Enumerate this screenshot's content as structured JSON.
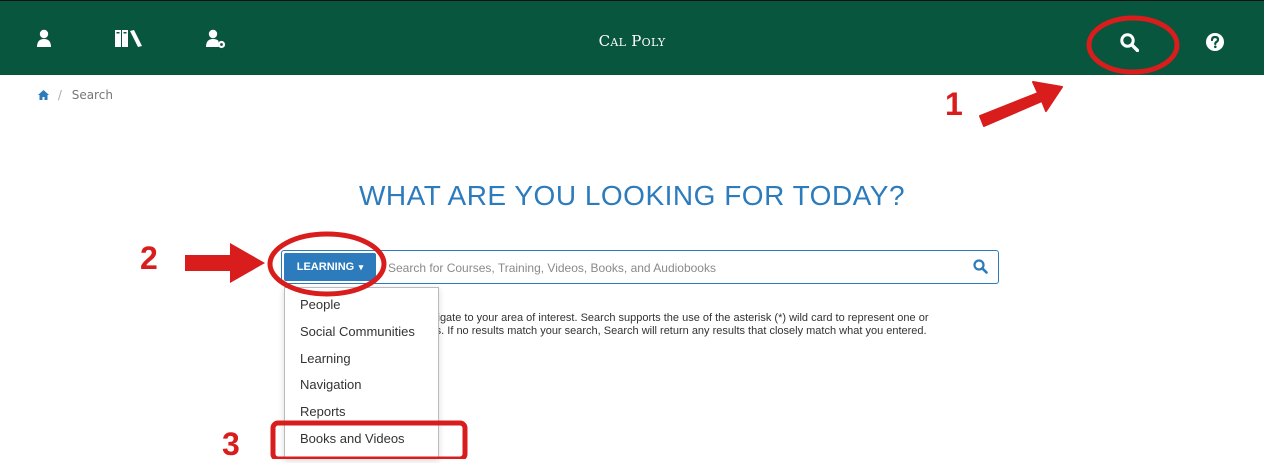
{
  "topbar": {
    "brand": "Cal Poly",
    "icons": [
      "user-icon",
      "library-icon",
      "user-settings-icon",
      "search-icon",
      "help-icon"
    ],
    "background_color": "#08563d"
  },
  "breadcrumb": {
    "home_icon": "home-icon",
    "separator": "/",
    "current": "Search"
  },
  "main": {
    "headline": "WHAT ARE YOU LOOKING FOR TODAY?",
    "headline_color": "#2b7bbd",
    "search": {
      "category_label": "LEARNING",
      "placeholder": "Search for Courses, Training, Videos, Books, and Audiobooks"
    },
    "help_line_1": "vigate to your area of interest. Search supports the use of the asterisk (*) wild card to represent one or",
    "help_line_2": "rs. If no results match your search, Search will return any results that closely match what you entered."
  },
  "dropdown": {
    "items": [
      "People",
      "Social Communities",
      "Learning",
      "Navigation",
      "Reports",
      "Books and Videos"
    ]
  },
  "annotations": {
    "step_1": "1",
    "step_2": "2",
    "step_3": "3",
    "color": "#d91c1c"
  }
}
